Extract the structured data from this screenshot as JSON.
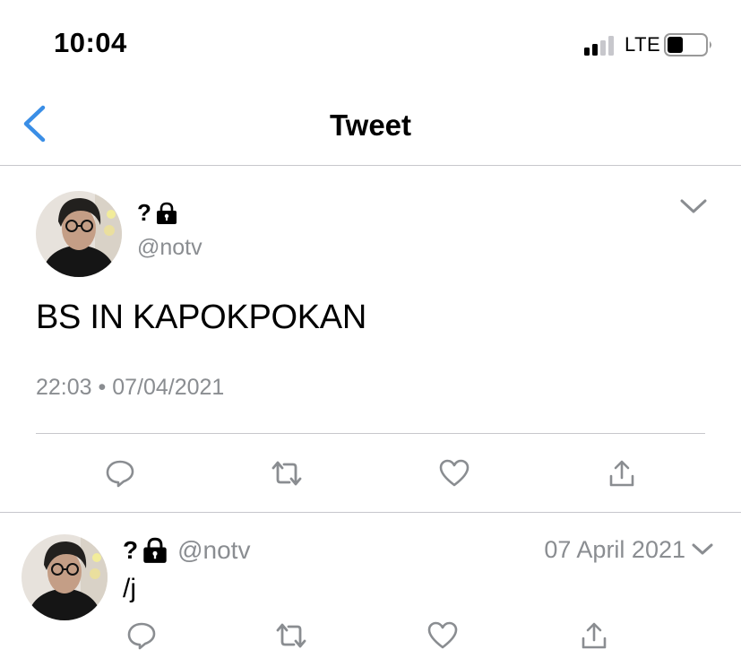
{
  "status_bar": {
    "time": "10:04",
    "network": "LTE",
    "signal_bars_active": 2,
    "signal_bars_total": 4
  },
  "nav": {
    "title": "Tweet",
    "back_icon": "chevron-left-icon"
  },
  "colors": {
    "accent": "#3a8ee6",
    "muted": "#8a8d91",
    "divider": "#c7c7cc"
  },
  "tweet": {
    "display_name": "?",
    "handle": "@notv",
    "text": "BS IN KAPOKPOKAN",
    "timestamp": "22:03 • 07/04/2021",
    "actions": [
      "reply-icon",
      "retweet-icon",
      "like-icon",
      "share-icon"
    ]
  },
  "reply": {
    "display_name": "?",
    "handle": "@notv",
    "date": "07 April 2021",
    "text": "/j",
    "actions": [
      "reply-icon",
      "retweet-icon",
      "like-icon",
      "share-icon"
    ]
  }
}
